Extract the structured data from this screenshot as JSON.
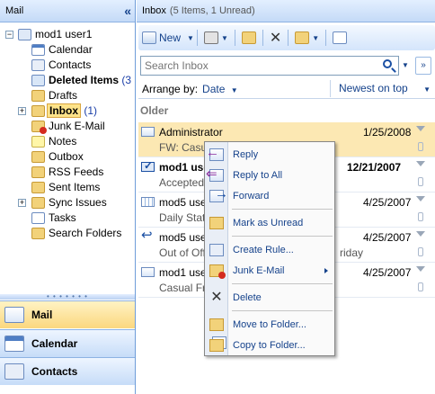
{
  "nav": {
    "title": "Mail",
    "collapse_glyph": "«",
    "tree": [
      {
        "label": "mod1 user1",
        "icon": "mailbox-icon",
        "bold": false
      },
      {
        "label": "Calendar",
        "icon": "calendar-icon"
      },
      {
        "label": "Contacts",
        "icon": "contacts-icon"
      },
      {
        "label": "Deleted Items",
        "count": "(3",
        "icon": "deleted-items-icon",
        "bold": true
      },
      {
        "label": "Drafts",
        "icon": "drafts-icon"
      },
      {
        "label": "Inbox",
        "count": "(1)",
        "icon": "inbox-icon",
        "bold": true,
        "selected": true
      },
      {
        "label": "Junk E-Mail",
        "icon": "junk-icon"
      },
      {
        "label": "Notes",
        "icon": "notes-icon"
      },
      {
        "label": "Outbox",
        "icon": "outbox-icon"
      },
      {
        "label": "RSS Feeds",
        "icon": "rss-feeds-icon"
      },
      {
        "label": "Sent Items",
        "icon": "sent-items-icon"
      },
      {
        "label": "Sync Issues",
        "icon": "sync-issues-icon"
      },
      {
        "label": "Tasks",
        "icon": "tasks-icon"
      },
      {
        "label": "Search Folders",
        "icon": "search-folders-icon"
      }
    ],
    "buttons": {
      "mail": "Mail",
      "calendar": "Calendar",
      "contacts": "Contacts"
    }
  },
  "main": {
    "header": {
      "title": "Inbox",
      "subtitle": "(5 Items, 1 Unread)"
    },
    "toolbar": {
      "new_label": "New"
    },
    "search": {
      "placeholder": "Search Inbox"
    },
    "arrange": {
      "label": "Arrange by:",
      "value": "Date",
      "sort": "Newest on top"
    },
    "group": "Older",
    "items": [
      {
        "from": "Administrator",
        "subject": "FW: Casual",
        "date": "1/25/2008",
        "icon": "envelope-icon",
        "unread": false,
        "selected": true
      },
      {
        "from": "mod1 user",
        "subject": "Accepted:",
        "date": "12/21/2007",
        "icon": "accepted-icon",
        "unread": true
      },
      {
        "from": "mod5 user",
        "subject": "Daily Stat",
        "date": "4/25/2007",
        "icon": "report-icon",
        "unread": false
      },
      {
        "from": "mod5 user",
        "subject": "Out of Off",
        "subject_tail": "riday",
        "date": "4/25/2007",
        "icon": "replied-icon",
        "unread": false
      },
      {
        "from": "mod1 user",
        "subject": "Casual Fri",
        "date": "4/25/2007",
        "icon": "envelope-icon",
        "unread": false
      }
    ]
  },
  "context_menu": {
    "items": {
      "reply": "Reply",
      "reply_all": "Reply to All",
      "forward": "Forward",
      "mark_unread": "Mark as Unread",
      "create_rule": "Create Rule...",
      "junk": "Junk E-Mail",
      "delete": "Delete",
      "move": "Move to Folder...",
      "copy": "Copy to Folder..."
    }
  }
}
